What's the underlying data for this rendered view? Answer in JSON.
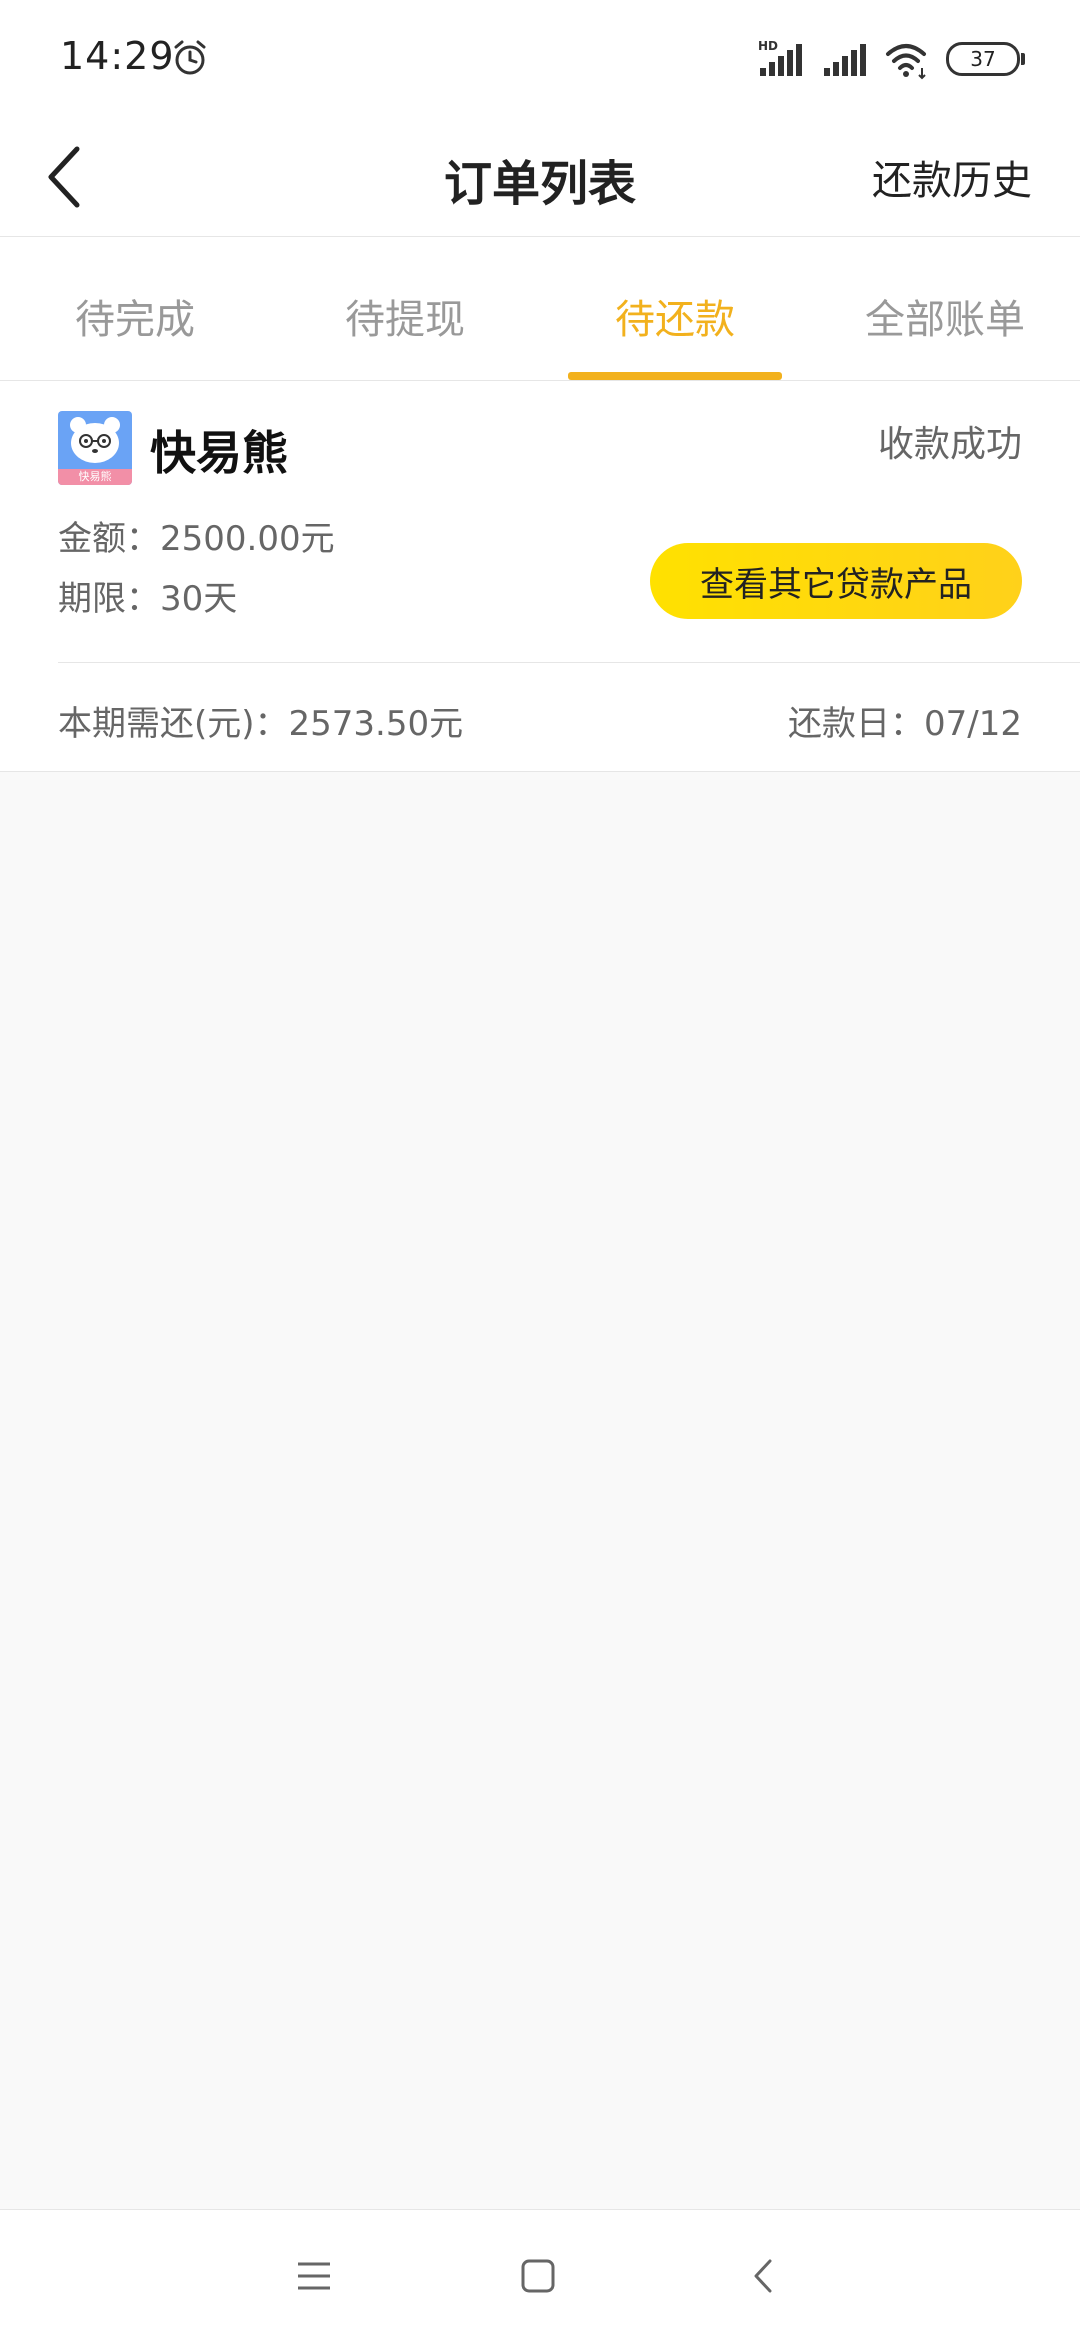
{
  "status_bar": {
    "time": "14:29",
    "battery": "37",
    "icons": [
      "alarm-icon",
      "hd-signal-icon",
      "signal-icon",
      "wifi-icon",
      "battery-icon"
    ]
  },
  "header": {
    "title": "订单列表",
    "back_icon": "chevron-left-icon",
    "right_link": "还款历史"
  },
  "tabs": [
    {
      "label": "待完成",
      "active": false
    },
    {
      "label": "待提现",
      "active": false
    },
    {
      "label": "待还款",
      "active": true
    },
    {
      "label": "全部账单",
      "active": false
    }
  ],
  "order": {
    "logo_text": "快易熊",
    "brand_name": "快易熊",
    "status": "收款成功",
    "amount": "金额：2500.00元",
    "term": "期限：30天",
    "cta_label": "查看其它贷款产品",
    "due_amount": "本期需还(元)：2573.50元",
    "due_date": "还款日：07/12"
  },
  "nav": {
    "menu_icon": "menu-icon",
    "home_icon": "home-square-icon",
    "back_icon": "back-chevron-icon"
  },
  "colors": {
    "accent": "#f2b11d",
    "button_yellow": "#ffe100",
    "background": "#f9f9f9"
  }
}
